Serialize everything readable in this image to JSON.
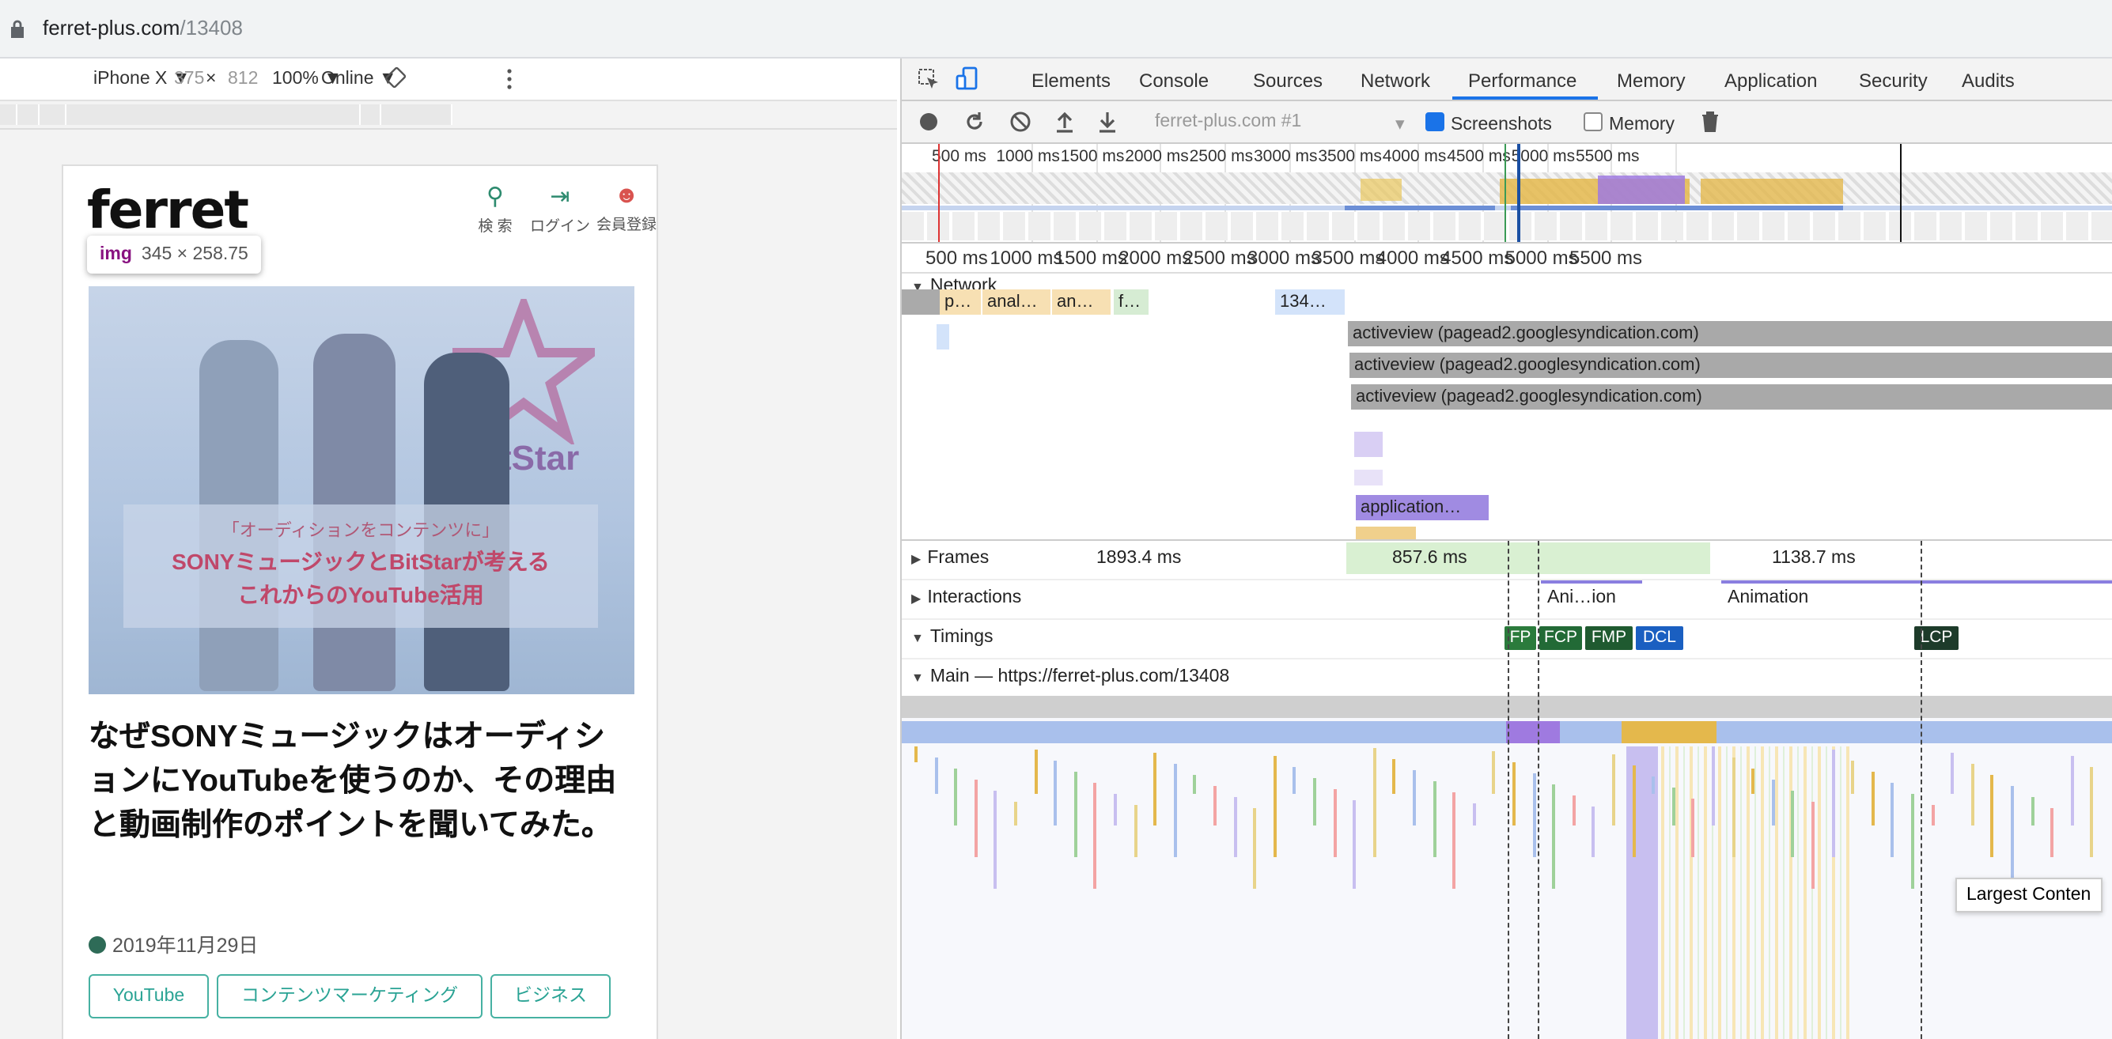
{
  "browser": {
    "url_host": "ferret-plus.com",
    "url_path": "/13408"
  },
  "device_toolbar": {
    "device": "iPhone X ▼",
    "width": "375",
    "times": "×",
    "height": "812",
    "zoom": "100% ▼",
    "network": "Online ▼"
  },
  "page": {
    "logo": "ferret",
    "header_buttons": [
      {
        "label": "検 索",
        "icon": "search-icon"
      },
      {
        "label": "ログイン",
        "icon": "login-icon"
      },
      {
        "label": "会員登録",
        "icon": "add-user-icon"
      }
    ],
    "inspect_tooltip": {
      "tag": "img",
      "size": "345 × 258.75"
    },
    "hero": {
      "brand": "BitStar",
      "caption_line1": "「オーディションをコンテンツに」",
      "caption_line2": "SONYミュージックとBitStarが考える",
      "caption_line3": "これからのYouTube活用"
    },
    "title": "なぜSONYミュージックはオーディションにYouTubeを使うのか、その理由と動画制作のポイントを聞いてみた。",
    "date": "2019年11月29日",
    "tags": [
      "YouTube",
      "コンテンツマーケティング",
      "ビジネス"
    ]
  },
  "devtools": {
    "tabs": [
      "Elements",
      "Console",
      "Sources",
      "Network",
      "Performance",
      "Memory",
      "Application",
      "Security",
      "Audits"
    ],
    "active_tab": "Performance",
    "recording_select": "ferret-plus.com #1",
    "screenshots_label": "Screenshots",
    "memory_label": "Memory",
    "overview_ticks": [
      "500 ms",
      "1000 ms",
      "1500 ms",
      "2000 ms",
      "2500 ms",
      "3000 ms",
      "3500 ms",
      "4000 ms",
      "4500 ms",
      "5000 ms",
      "5500 ms"
    ],
    "scale_ticks": [
      "500 ms",
      "1000 ms",
      "1500 ms",
      "2000 ms",
      "2500 ms",
      "3000 ms",
      "3500 ms",
      "4000 ms",
      "4500 ms",
      "5000 ms",
      "5500 ms"
    ],
    "network_label": "Network",
    "network_small": [
      "p…",
      "anal…",
      "an…",
      "f…",
      "134…"
    ],
    "network_requests": [
      "activeview (pagead2.googlesyndication.com)",
      "activeview (pagead2.googlesyndication.com)",
      "activeview (pagead2.googlesyndication.com)"
    ],
    "network_app": "application…",
    "frames_label": "Frames",
    "frames_values": [
      "1893.4 ms",
      "857.6 ms",
      "1138.7 ms"
    ],
    "interactions_label": "Interactions",
    "interactions": [
      "Ani…ion",
      "Animation"
    ],
    "timings_label": "Timings",
    "timings": [
      "FP",
      "FCP",
      "FMP",
      "DCL",
      "LCP"
    ],
    "main_label": "Main — https://ferret-plus.com/13408",
    "tooltip": "Largest Conten",
    "colors": {
      "accent": "#1a73e8",
      "fp": "#2b7b3c",
      "fcp": "#226a36",
      "fmp": "#1f5a30",
      "dcl": "#1a5fc1",
      "lcp": "#1d3b2a"
    }
  }
}
